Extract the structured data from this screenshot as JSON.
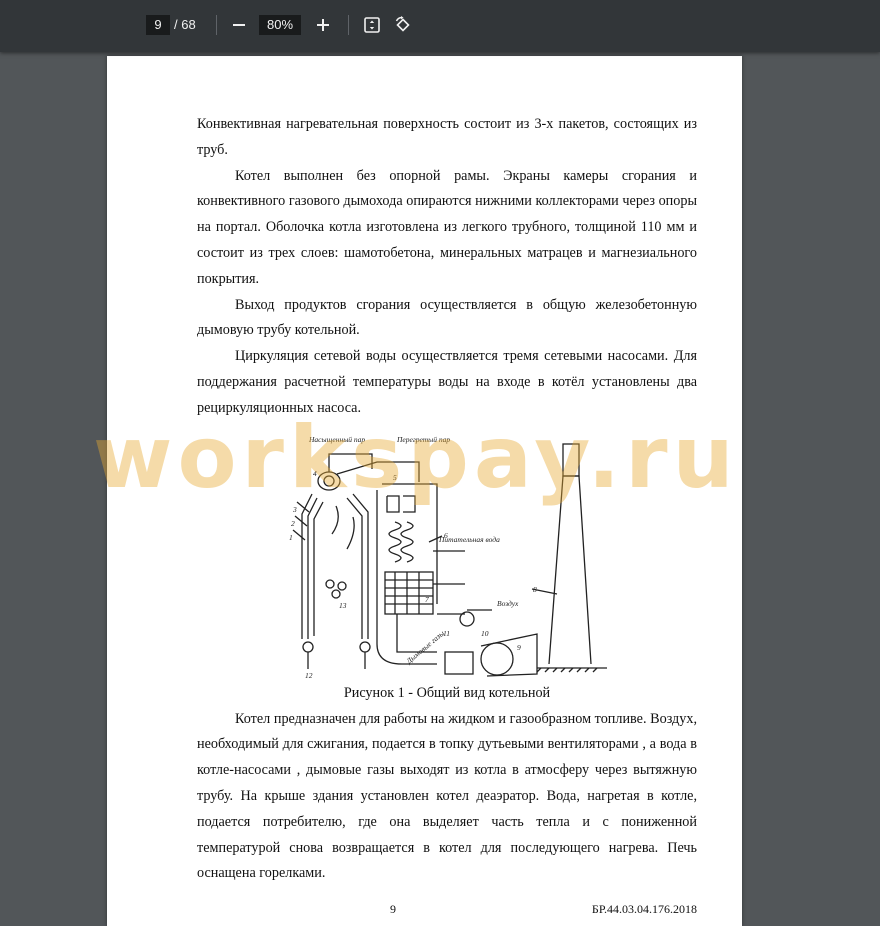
{
  "toolbar": {
    "current_page": "9",
    "page_total": "/ 68",
    "zoom": "80%",
    "icons": {
      "zoom_out": "minus-icon",
      "zoom_in": "plus-icon",
      "fit": "fit-to-page-icon",
      "rotate": "rotate-icon"
    }
  },
  "document": {
    "paragraphs": [
      "Конвективная нагревательная поверхность состоит из 3-х пакетов, состоящих из труб.",
      "Котел выполнен без опорной рамы. Экраны камеры сгорания и конвективного газового дымохода опираются  нижними коллекторами через опоры на портал. Оболочка котла изготовлена из легкого трубного, толщиной 110 мм и состоит из трех слоев: шамотобетона, минеральных матрацев и магнезиального покрытия.",
      "Выход продуктов сгорания осуществляется в общую железобетонную дымовую трубу котельной.",
      "Циркуляция сетевой воды осуществляется тремя сетевыми насосами. Для поддержания расчетной температуры воды на входе в котёл установлены два рециркуляционных насоса."
    ],
    "figure": {
      "labels": {
        "steam_saturated": "Насыщенный пар",
        "steam_superheated": "Перегретый пар",
        "feed_water": "Питательная вода",
        "air": "Воздух",
        "flue": "Дымовые газы",
        "n1": "1",
        "n2": "2",
        "n3": "3",
        "n4": "4",
        "n5": "5",
        "n6": "6",
        "n7": "7",
        "n8": "8",
        "n9": "9",
        "n10": "10",
        "n11": "11",
        "n12": "12",
        "n13": "13"
      },
      "caption": "Рисунок 1 - Общий вид котельной"
    },
    "after_paragraph": "Котел предназначен для работы на жидком и газообразном топливе. Воздух, необходимый для сжигания, подается в топку дутьевыми вентиляторами , а вода в котле-насосами , дымовые газы выходят из котла в атмосферу через вытяжную трубу. На крыше здания установлен котел деаэратор. Вода, нагретая в котле, подается потребителю, где она выделяет часть тепла и с пониженной температурой снова возвращается в котел для последующего нагрева. Печь оснащена горелками.",
    "page_number": "9",
    "doc_code": "БР.44.03.04.176.2018",
    "watermark": "workspay.ru"
  },
  "colors": {
    "toolbar_bg": "#323639",
    "viewer_bg": "#525659",
    "watermark": "#e8aa32"
  }
}
